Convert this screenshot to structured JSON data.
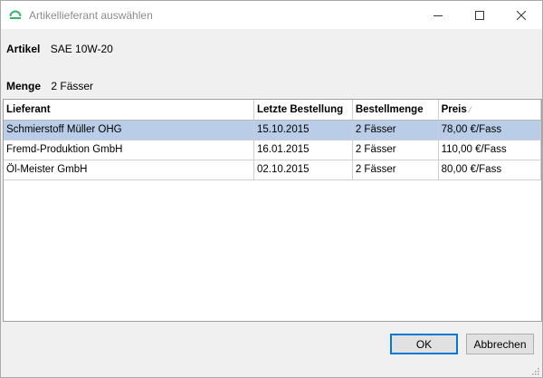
{
  "window": {
    "title": "Artikellieferant auswählen",
    "controls": {
      "minimize_icon": "minimize-icon",
      "maximize_icon": "maximize-icon",
      "close_icon": "close-icon"
    }
  },
  "fields": {
    "article_label": "Artikel",
    "article_value": "SAE 10W-20",
    "quantity_label": "Menge",
    "quantity_value": "2 Fässer"
  },
  "grid": {
    "columns": [
      "Lieferant",
      "Letzte Bestellung",
      "Bestellmenge",
      "Preis"
    ],
    "sorted_column": "Preis",
    "rows": [
      [
        "Schmierstoff Müller OHG",
        "15.10.2015",
        "2 Fässer",
        "78,00 €/Fass"
      ],
      [
        "Fremd-Produktion GmbH",
        "16.01.2015",
        "2 Fässer",
        "110,00 €/Fass"
      ],
      [
        "Öl-Meister GmbH",
        "02.10.2015",
        "2 Fässer",
        "80,00 €/Fass"
      ]
    ],
    "selected_row": "Schmierstoff Müller OHG"
  },
  "buttons": {
    "ok_label": "OK",
    "cancel_label": "Abbrechen"
  },
  "colors": {
    "selection": "#b9cde8",
    "default_button_border": "#0078d7",
    "app_icon": "#3cb371"
  }
}
